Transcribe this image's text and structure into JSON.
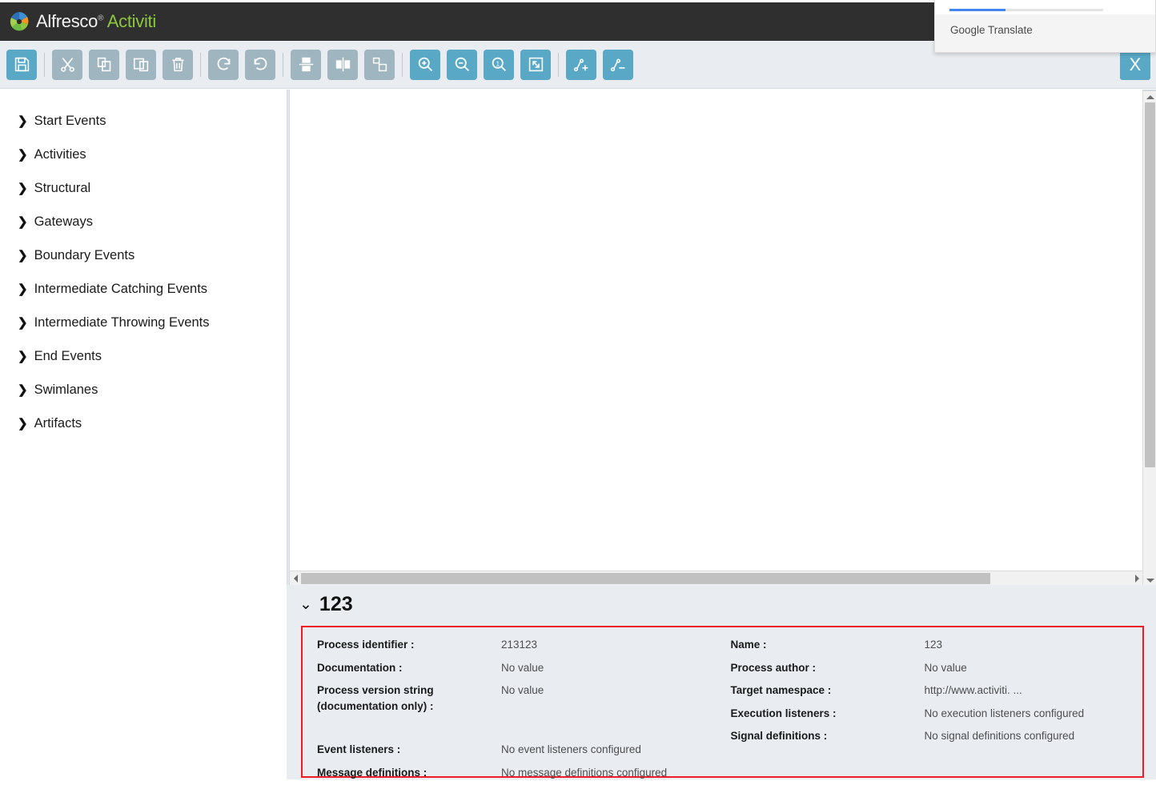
{
  "header": {
    "brand_primary": "Alfresco",
    "brand_secondary": "Activiti",
    "registered_mark": "®",
    "background": "#2f2f2f",
    "accent_green": "#8cc63e"
  },
  "translate_popup": {
    "label": "Google Translate",
    "progress_color": "#4285f4",
    "progress_percent": 36
  },
  "toolbar": {
    "accent_color": "#58a8c6",
    "idle_color": "#9fb5bf",
    "buttons": [
      {
        "name": "save-button",
        "icon": "save-icon",
        "label": "Save",
        "active": true
      },
      {
        "name": "cut-button",
        "icon": "scissors-icon",
        "label": "Cut",
        "active": false
      },
      {
        "name": "copy-button",
        "icon": "copy-icon",
        "label": "Copy",
        "active": false
      },
      {
        "name": "paste-button",
        "icon": "paste-icon",
        "label": "Paste",
        "active": false
      },
      {
        "name": "delete-button",
        "icon": "trash-icon",
        "label": "Delete",
        "active": false
      },
      {
        "name": "redo-button",
        "icon": "redo-arrow-icon",
        "label": "Redo",
        "active": false
      },
      {
        "name": "undo-button",
        "icon": "undo-arrow-icon",
        "label": "Undo",
        "active": false
      },
      {
        "name": "align-vertical-button",
        "icon": "align-vertical-icon",
        "label": "Align vertical",
        "active": false
      },
      {
        "name": "align-horizontal-button",
        "icon": "align-horizontal-icon",
        "label": "Align horizontal",
        "active": false
      },
      {
        "name": "same-size-button",
        "icon": "same-size-icon",
        "label": "Same size",
        "active": false
      },
      {
        "name": "zoom-in-button",
        "icon": "zoom-in-icon",
        "label": "Zoom in",
        "active": true
      },
      {
        "name": "zoom-out-button",
        "icon": "zoom-out-icon",
        "label": "Zoom out",
        "active": true
      },
      {
        "name": "zoom-actual-button",
        "icon": "zoom-actual-icon",
        "label": "Zoom actual size",
        "active": true
      },
      {
        "name": "zoom-fit-button",
        "icon": "zoom-fit-icon",
        "label": "Zoom fit",
        "active": true
      },
      {
        "name": "add-bendpoint-button",
        "icon": "add-bendpoint-icon",
        "label": "Add bendpoint",
        "active": true
      },
      {
        "name": "remove-bendpoint-button",
        "icon": "remove-bendpoint-icon",
        "label": "Remove bendpoint",
        "active": true
      }
    ],
    "close_label": "X"
  },
  "palette": {
    "items": [
      {
        "label": "Start Events"
      },
      {
        "label": "Activities"
      },
      {
        "label": "Structural"
      },
      {
        "label": "Gateways"
      },
      {
        "label": "Boundary Events"
      },
      {
        "label": "Intermediate Catching Events"
      },
      {
        "label": "Intermediate Throwing Events"
      },
      {
        "label": "End Events"
      },
      {
        "label": "Swimlanes"
      },
      {
        "label": "Artifacts"
      }
    ],
    "chevron": "❯"
  },
  "properties": {
    "title": "123",
    "collapse_chevron": "⌄",
    "highlight_color": "#ee1c25",
    "left_column": [
      {
        "label": "Process identifier :",
        "value": "213123"
      },
      {
        "label": "Documentation :",
        "value": "No value"
      },
      {
        "label": "Process version string (documentation only) :",
        "value": "No value"
      },
      {
        "label": "Event listeners :",
        "value": "No event listeners configured"
      },
      {
        "label": "Message definitions :",
        "value": "No message definitions configured"
      }
    ],
    "right_column": [
      {
        "label": "Name :",
        "value": "123"
      },
      {
        "label": "Process author :",
        "value": "No value"
      },
      {
        "label": "Target namespace :",
        "value": "http://www.activiti. ..."
      },
      {
        "label": "Execution listeners :",
        "value": "No execution listeners configured"
      },
      {
        "label": "Signal definitions :",
        "value": "No signal definitions configured"
      }
    ]
  },
  "scrollbars": {
    "vertical_thumb_percent": 74,
    "horizontal_thumb_percent": 82
  }
}
